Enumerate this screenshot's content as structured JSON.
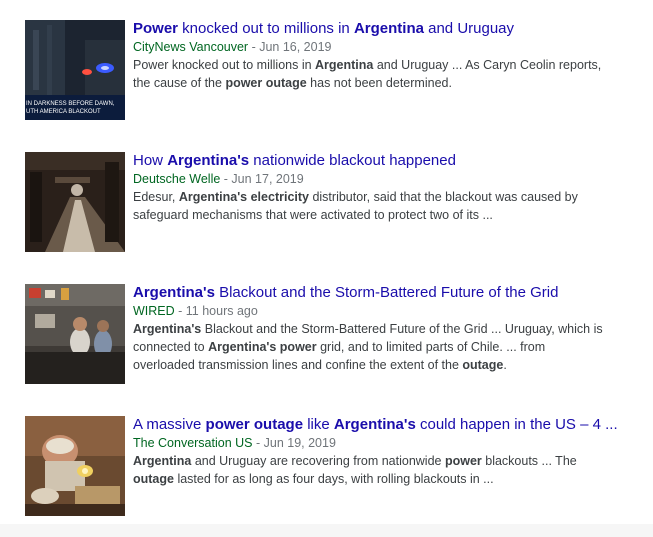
{
  "results": [
    {
      "title_parts": [
        {
          "text": "Power",
          "bold": true
        },
        {
          "text": " knocked out to millions in ",
          "bold": false
        },
        {
          "text": "Argentina",
          "bold": true
        },
        {
          "text": " and Uruguay",
          "bold": false
        }
      ],
      "source": "CityNews Vancouver",
      "date": " - Jun 16, 2019",
      "snippet_lines": [
        [
          {
            "text": "Power knocked out to millions in ",
            "bold": false
          },
          {
            "text": "Argentina",
            "bold": true
          },
          {
            "text": " and Uruguay ... As Caryn Ceolin reports,",
            "bold": false
          }
        ],
        [
          {
            "text": "the cause of the ",
            "bold": false
          },
          {
            "text": "power outage",
            "bold": true
          },
          {
            "text": " has not been determined.",
            "bold": false
          }
        ]
      ],
      "thumb_caption": [
        "IN DARKNESS BEFORE DAWN,",
        "UTH AMERICA BLACKOUT"
      ]
    },
    {
      "title_parts": [
        {
          "text": "How ",
          "bold": false
        },
        {
          "text": "Argentina's",
          "bold": true
        },
        {
          "text": " nationwide blackout happened",
          "bold": false
        }
      ],
      "source": "Deutsche Welle",
      "date": " - Jun 17, 2019",
      "snippet_lines": [
        [
          {
            "text": "Edesur, ",
            "bold": false
          },
          {
            "text": "Argentina's electricity",
            "bold": true
          },
          {
            "text": " distributor, said that the blackout was caused by",
            "bold": false
          }
        ],
        [
          {
            "text": "safeguard mechanisms that were activated to protect two of its ...",
            "bold": false
          }
        ]
      ]
    },
    {
      "title_parts": [
        {
          "text": "Argentina's",
          "bold": true
        },
        {
          "text": " Blackout and the Storm-Battered Future of the Grid",
          "bold": false
        }
      ],
      "source": "WIRED",
      "date": " - 11 hours ago",
      "snippet_lines": [
        [
          {
            "text": "Argentina's",
            "bold": true
          },
          {
            "text": " Blackout and the Storm-Battered Future of the Grid ... Uruguay, which is",
            "bold": false
          }
        ],
        [
          {
            "text": "connected to ",
            "bold": false
          },
          {
            "text": "Argentina's power",
            "bold": true
          },
          {
            "text": " grid, and to limited parts of Chile. ... from",
            "bold": false
          }
        ],
        [
          {
            "text": "overloaded transmission lines and confine the extent of the ",
            "bold": false
          },
          {
            "text": "outage",
            "bold": true
          },
          {
            "text": ".",
            "bold": false
          }
        ]
      ]
    },
    {
      "title_parts": [
        {
          "text": "A massive ",
          "bold": false
        },
        {
          "text": "power outage",
          "bold": true
        },
        {
          "text": " like ",
          "bold": false
        },
        {
          "text": "Argentina's",
          "bold": true
        },
        {
          "text": " could happen in the US – 4 ...",
          "bold": false
        }
      ],
      "source": "The Conversation US",
      "date": " - Jun 19, 2019",
      "snippet_lines": [
        [
          {
            "text": "Argentina",
            "bold": true
          },
          {
            "text": " and Uruguay are recovering from nationwide ",
            "bold": false
          },
          {
            "text": "power",
            "bold": true
          },
          {
            "text": " blackouts ... The",
            "bold": false
          }
        ],
        [
          {
            "text": "outage",
            "bold": true
          },
          {
            "text": " lasted for as long as four days, with rolling blackouts in ...",
            "bold": false
          }
        ]
      ]
    }
  ],
  "colors": {
    "title": "#1a0dab",
    "source": "#006621",
    "date": "#70757a",
    "snippet": "#3c4043"
  }
}
